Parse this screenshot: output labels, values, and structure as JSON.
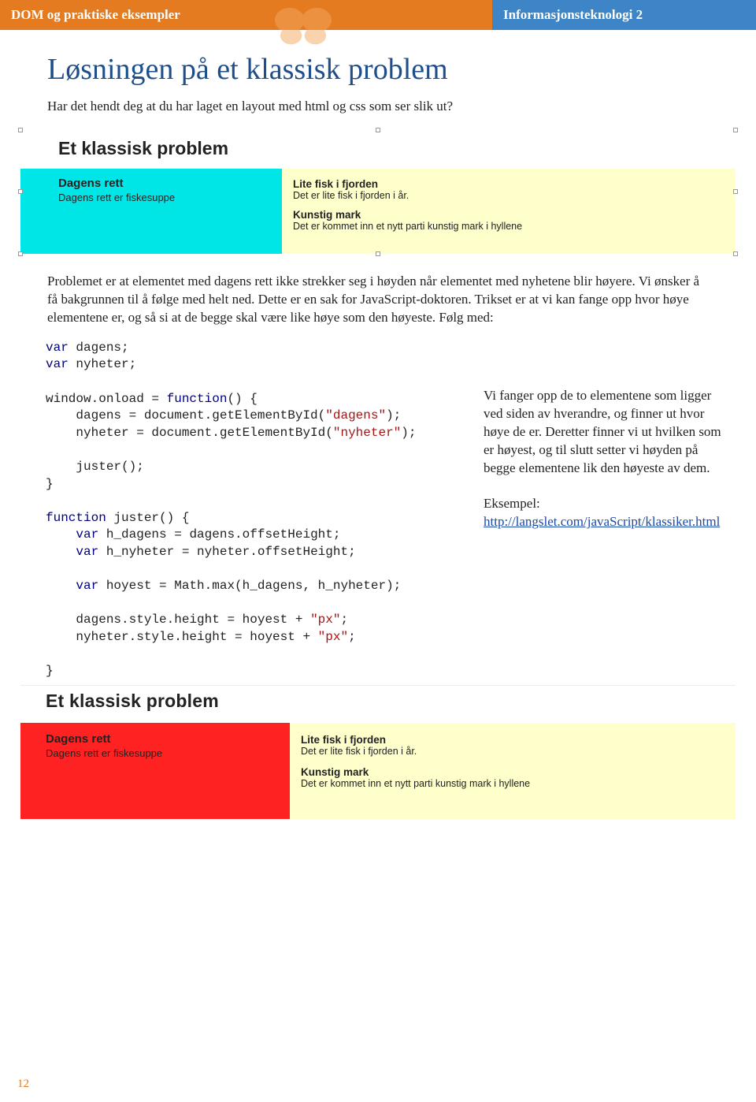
{
  "header": {
    "left": "DOM og praktiske eksempler",
    "right": "Informasjonsteknologi 2"
  },
  "title": "Løsningen på et klassisk problem",
  "intro": "Har det hendt deg at du har laget en layout med html og css som ser slik ut?",
  "example1": {
    "heading": "Et klassisk problem",
    "left_h": "Dagens rett",
    "left_p": "Dagens rett er fiskesuppe",
    "r1_h": "Lite fisk i fjorden",
    "r1_p": "Det er lite fisk i fjorden i år.",
    "r2_h": "Kunstig mark",
    "r2_p": "Det er kommet inn et nytt parti kunstig mark i hyllene"
  },
  "para": "Problemet er at elementet med dagens rett ikke strekker seg i høyden når elementet med nyhetene blir høyere. Vi ønsker å få bakgrunnen til å følge med helt ned. Dette er en sak for JavaScript-doktoren. Trikset er at vi kan fange opp hvor høye elementene er, og så si at de begge skal være like høye som den høyeste. Følg med:",
  "code_lines": [
    {
      "pre": "",
      "kw": "var",
      "rest": " dagens;"
    },
    {
      "pre": "",
      "kw": "var",
      "rest": " nyheter;"
    },
    {
      "pre": "",
      "kw": "",
      "rest": ""
    },
    {
      "pre": "window.onload = ",
      "kw": "function",
      "rest": "() {"
    },
    {
      "pre": "    dagens = document.getElementById(",
      "kw": "",
      "str": "\"dagens\"",
      "rest": ");"
    },
    {
      "pre": "    nyheter = document.getElementById(",
      "kw": "",
      "str": "\"nyheter\"",
      "rest": ");"
    },
    {
      "pre": "",
      "kw": "",
      "rest": ""
    },
    {
      "pre": "    juster();",
      "kw": "",
      "rest": ""
    },
    {
      "pre": "}",
      "kw": "",
      "rest": ""
    },
    {
      "pre": "",
      "kw": "",
      "rest": ""
    },
    {
      "pre": "",
      "kw": "function",
      "rest": " juster() {"
    },
    {
      "pre": "    ",
      "kw": "var",
      "rest": " h_dagens = dagens.offsetHeight;"
    },
    {
      "pre": "    ",
      "kw": "var",
      "rest": " h_nyheter = nyheter.offsetHeight;"
    },
    {
      "pre": "",
      "kw": "",
      "rest": ""
    },
    {
      "pre": "    ",
      "kw": "var",
      "rest": " hoyest = Math.max(h_dagens, h_nyheter);"
    },
    {
      "pre": "",
      "kw": "",
      "rest": ""
    },
    {
      "pre": "    dagens.style.height = hoyest + ",
      "kw": "",
      "str": "\"px\"",
      "rest": ";"
    },
    {
      "pre": "    nyheter.style.height = hoyest + ",
      "kw": "",
      "str": "\"px\"",
      "rest": ";"
    },
    {
      "pre": "",
      "kw": "",
      "rest": ""
    },
    {
      "pre": "}",
      "kw": "",
      "rest": ""
    }
  ],
  "aside": {
    "p1": "Vi fanger opp de to elementene som ligger ved siden av hverandre, og finner ut hvor høye de er. Deretter finner vi ut hvilken som er høyest, og til slutt setter vi høyden på begge elementene lik den høyeste av dem.",
    "ex_label": "Eksempel:",
    "link": "http://langslet.com/javaScript/klassiker.html"
  },
  "example2": {
    "heading": "Et klassisk problem",
    "left_h": "Dagens rett",
    "left_p": "Dagens rett er fiskesuppe",
    "r1_h": "Lite fisk i fjorden",
    "r1_p": "Det er lite fisk i fjorden i år.",
    "r2_h": "Kunstig mark",
    "r2_p": "Det er kommet inn et nytt parti kunstig mark i hyllene"
  },
  "page_number": "12"
}
